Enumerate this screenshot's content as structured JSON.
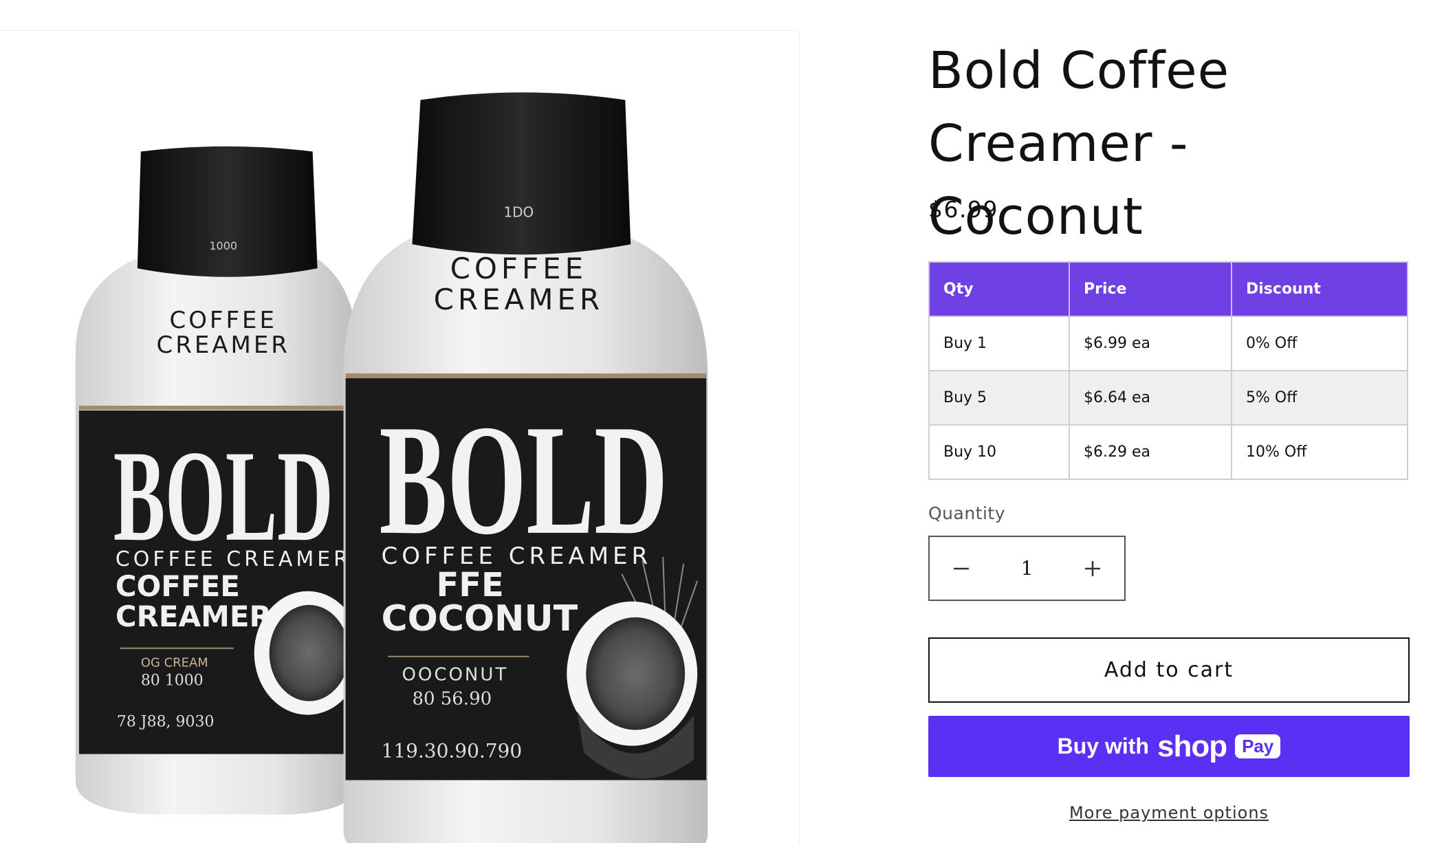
{
  "product": {
    "title": "Bold Coffee Creamer - Coconut",
    "price": "$6.99"
  },
  "image": {
    "bottle_left": {
      "neck_text": "1000",
      "top_label": [
        "COFFEE",
        "CREAMER"
      ],
      "brand": "BOLD",
      "subtitle": "COFFEE CREAMER",
      "flavor": [
        "COFFEE",
        "CREAMER"
      ],
      "small_lines": [
        "OG CREAM",
        "80 1000"
      ],
      "bottom": "78 J88, 9030"
    },
    "bottle_right": {
      "neck_text": "1DO",
      "top_label": [
        "COFFEE",
        "CREAMER"
      ],
      "brand": "BOLD",
      "subtitle": "COFFEE CREAMER",
      "flavor": [
        "FFE",
        "COCONUT"
      ],
      "small_lines": [
        "OOCONUT",
        "80 56.90"
      ],
      "bottom": "119.30.90.790"
    },
    "colors": {
      "label": "#1a1a1a",
      "bottle": "#e3e3e3",
      "cap": "#151515"
    }
  },
  "volume_table": {
    "headers": [
      "Qty",
      "Price",
      "Discount"
    ],
    "rows": [
      [
        "Buy 1",
        "$6.99 ea",
        "0% Off"
      ],
      [
        "Buy 5",
        "$6.64 ea",
        "5% Off"
      ],
      [
        "Buy 10",
        "$6.29 ea",
        "10% Off"
      ]
    ],
    "header_color": "#6f40e3"
  },
  "quantity": {
    "label": "Quantity",
    "value": "1",
    "decrement_icon": "minus-icon",
    "increment_icon": "plus-icon"
  },
  "actions": {
    "add_to_cart": "Add to cart",
    "shop_pay_prefix": "Buy with",
    "shop_pay_brand": "shop",
    "shop_pay_badge": "Pay",
    "shop_pay_color": "#5a31f4",
    "more_payment": "More payment options"
  }
}
